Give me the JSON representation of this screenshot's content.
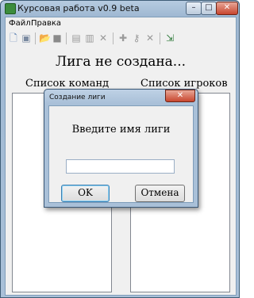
{
  "window": {
    "title": "Курсовая работа v0.9 beta",
    "minimize_glyph": "–",
    "maximize_glyph": "□",
    "close_glyph": "✕"
  },
  "menu": {
    "items": [
      "Файл",
      "Правка"
    ]
  },
  "toolbar": {
    "icons": [
      {
        "name": "new-document-icon",
        "glyph": "🗋",
        "color": "#5a7fb0"
      },
      {
        "name": "team-icon",
        "glyph": "▣",
        "color": "#7a8aa0"
      },
      {
        "name": "open-folder-icon",
        "glyph": "📂",
        "color": "#d2a63a"
      },
      {
        "name": "save-icon",
        "glyph": "■",
        "color": "#8a8a8a"
      },
      {
        "name": "copy-icon",
        "glyph": "▤",
        "color": "#9a9a9a"
      },
      {
        "name": "paste-icon",
        "glyph": "▥",
        "color": "#9a9a9a"
      },
      {
        "name": "delete-icon",
        "glyph": "✕",
        "color": "#9a9a9a"
      },
      {
        "name": "add-icon",
        "glyph": "✚",
        "color": "#9a9a9a"
      },
      {
        "name": "key-icon",
        "glyph": "⚷",
        "color": "#9a9a9a"
      },
      {
        "name": "remove-icon",
        "glyph": "✕",
        "color": "#9a9a9a"
      },
      {
        "name": "exit-icon",
        "glyph": "⇲",
        "color": "#2e7a3a"
      }
    ]
  },
  "main": {
    "heading": "Лига не создана...",
    "left_column_title": "Список команд",
    "right_column_title": "Список игроков"
  },
  "dialog": {
    "title": "Создание лиги",
    "close_glyph": "✕",
    "prompt": "Введите имя лиги",
    "input_value": "",
    "ok_label": "OK",
    "cancel_label": "Отмена"
  }
}
